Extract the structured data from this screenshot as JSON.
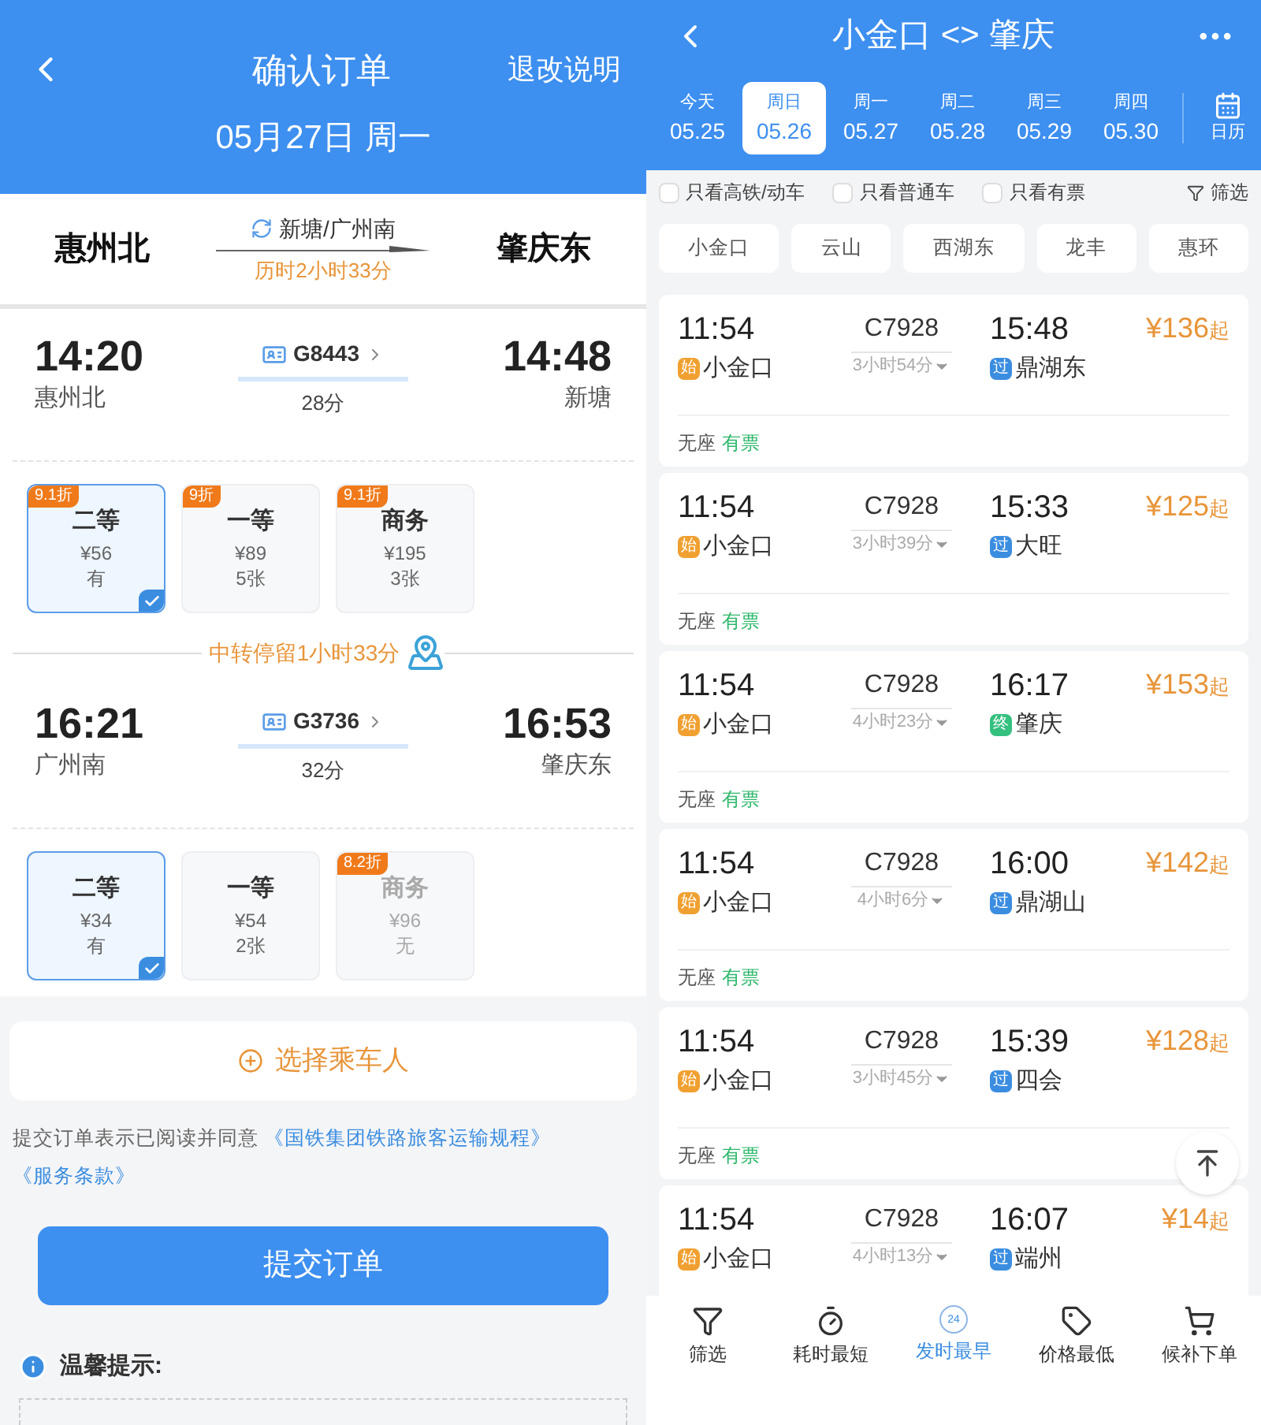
{
  "order": {
    "header": {
      "title": "确认订单",
      "action": "退改说明",
      "date": "05月27日 周一"
    },
    "route": {
      "from": "惠州北",
      "via": "新塘/广州南",
      "duration": "历时2小时33分",
      "to": "肇庆东"
    },
    "legs": [
      {
        "depart_time": "14:20",
        "depart_station": "惠州北",
        "train": "G8443",
        "duration": "28分",
        "arrive_time": "14:48",
        "arrive_station": "新塘",
        "seats": [
          {
            "discount": "9.1折",
            "name": "二等",
            "price": "¥56",
            "availability": "有",
            "selected": true,
            "disabled": false
          },
          {
            "discount": "9折",
            "name": "一等",
            "price": "¥89",
            "availability": "5张",
            "selected": false,
            "disabled": false
          },
          {
            "discount": "9.1折",
            "name": "商务",
            "price": "¥195",
            "availability": "3张",
            "selected": false,
            "disabled": false
          }
        ]
      },
      {
        "depart_time": "16:21",
        "depart_station": "广州南",
        "train": "G3736",
        "duration": "32分",
        "arrive_time": "16:53",
        "arrive_station": "肇庆东",
        "seats": [
          {
            "name": "二等",
            "price": "¥34",
            "availability": "有",
            "selected": true,
            "disabled": false
          },
          {
            "name": "一等",
            "price": "¥54",
            "availability": "2张",
            "selected": false,
            "disabled": false
          },
          {
            "discount": "8.2折",
            "name": "商务",
            "price": "¥96",
            "availability": "无",
            "selected": false,
            "disabled": true
          }
        ]
      }
    ],
    "transfer": "中转停留1小时33分",
    "passenger_button": "选择乘车人",
    "terms": {
      "text": "提交订单表示已阅读并同意",
      "links": [
        "《国铁集团铁路旅客运输规程》",
        "《服务条款》"
      ]
    },
    "submit_button": "提交订单",
    "tips_title": "温馨提示:"
  },
  "search": {
    "title": "小金口 <> 肇庆",
    "dates": [
      {
        "day": "今天",
        "date": "05.25",
        "selected": false
      },
      {
        "day": "周日",
        "date": "05.26",
        "selected": true
      },
      {
        "day": "周一",
        "date": "05.27",
        "selected": false
      },
      {
        "day": "周二",
        "date": "05.28",
        "selected": false
      },
      {
        "day": "周三",
        "date": "05.29",
        "selected": false
      },
      {
        "day": "周四",
        "date": "05.30",
        "selected": false
      }
    ],
    "calendar": "日历",
    "filters": [
      {
        "label": "只看高铁/动车",
        "checked": false
      },
      {
        "label": "只看普通车",
        "checked": false
      },
      {
        "label": "只看有票",
        "checked": false
      }
    ],
    "filter_button": "筛选",
    "stations": [
      "小金口",
      "云山",
      "西湖东",
      "龙丰",
      "惠环"
    ],
    "trains": [
      {
        "depart": "11:54",
        "train": "C7928",
        "arrive": "15:48",
        "from_tag": "始",
        "from_station": "小金口",
        "duration": "3小时54分",
        "to_tag": {
          "text": "过",
          "color": "#3b8de0"
        },
        "to_station": "鼎湖东",
        "price": "¥136",
        "price_suffix": "起",
        "seat": "无座",
        "availability": "有票"
      },
      {
        "depart": "11:54",
        "train": "C7928",
        "arrive": "15:33",
        "from_tag": "始",
        "from_station": "小金口",
        "duration": "3小时39分",
        "to_tag": {
          "text": "过",
          "color": "#3b8de0"
        },
        "to_station": "大旺",
        "price": "¥125",
        "price_suffix": "起",
        "seat": "无座",
        "availability": "有票"
      },
      {
        "depart": "11:54",
        "train": "C7928",
        "arrive": "16:17",
        "from_tag": "始",
        "from_station": "小金口",
        "duration": "4小时23分",
        "to_tag": {
          "text": "终",
          "color": "#34c07f"
        },
        "to_station": "肇庆",
        "price": "¥153",
        "price_suffix": "起",
        "seat": "无座",
        "availability": "有票"
      },
      {
        "depart": "11:54",
        "train": "C7928",
        "arrive": "16:00",
        "from_tag": "始",
        "from_station": "小金口",
        "duration": "4小时6分",
        "to_tag": {
          "text": "过",
          "color": "#3b8de0"
        },
        "to_station": "鼎湖山",
        "price": "¥142",
        "price_suffix": "起",
        "seat": "无座",
        "availability": "有票"
      },
      {
        "depart": "11:54",
        "train": "C7928",
        "arrive": "15:39",
        "from_tag": "始",
        "from_station": "小金口",
        "duration": "3小时45分",
        "to_tag": {
          "text": "过",
          "color": "#3b8de0"
        },
        "to_station": "四会",
        "price": "¥128",
        "price_suffix": "起",
        "seat": "无座",
        "availability": "有票"
      },
      {
        "depart": "11:54",
        "train": "C7928",
        "arrive": "16:07",
        "from_tag": "始",
        "from_station": "小金口",
        "duration": "4小时13分",
        "to_tag": {
          "text": "过",
          "color": "#3b8de0"
        },
        "to_station": "端州",
        "price": "¥14",
        "price_suffix": "起"
      }
    ],
    "bottom_nav": [
      {
        "kind": "filter",
        "label": "筛选",
        "selected": false
      },
      {
        "kind": "timer",
        "label": "耗时最短",
        "selected": false
      },
      {
        "kind": "clock",
        "badge": "24",
        "label": "发时最早",
        "selected": true
      },
      {
        "kind": "tag",
        "label": "价格最低",
        "selected": false
      },
      {
        "kind": "cart",
        "label": "候补下单",
        "selected": false
      }
    ]
  }
}
